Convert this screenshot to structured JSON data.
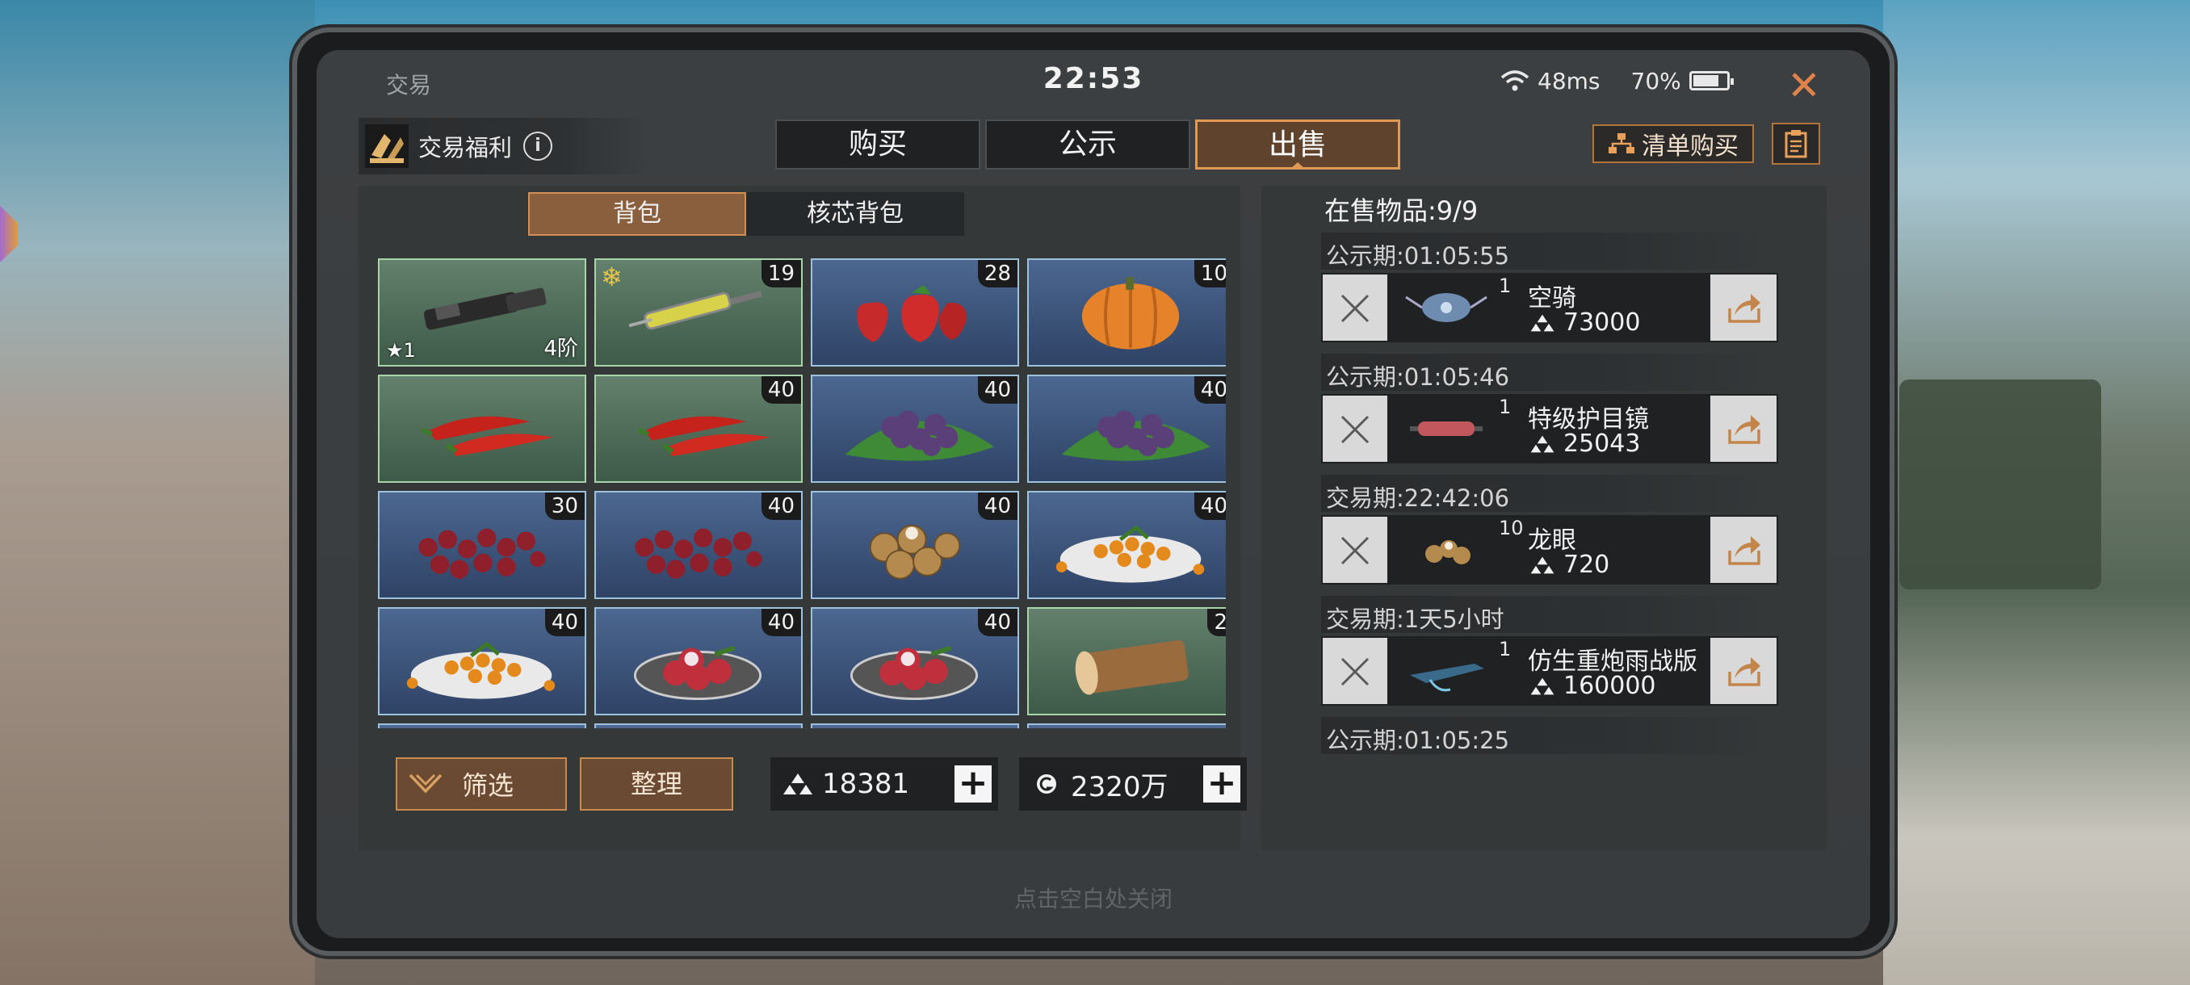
{
  "status": {
    "title": "交易",
    "time": "22:53",
    "latency": "48ms",
    "battery": "70%"
  },
  "header": {
    "welfare_label": "交易福利",
    "tabs": [
      {
        "label": "购买"
      },
      {
        "label": "公示"
      },
      {
        "label": "出售",
        "active": true
      }
    ],
    "list_buy_label": "清单购买"
  },
  "inventory": {
    "tabs": [
      {
        "label": "背包",
        "active": true
      },
      {
        "label": "核芯背包"
      }
    ],
    "items": [
      {
        "name": "muzzle",
        "style": "green",
        "tier": "4阶",
        "star": "★1"
      },
      {
        "name": "syringe",
        "style": "green",
        "count": "19",
        "frozen": true
      },
      {
        "name": "strawberry",
        "style": "blue",
        "count": "28"
      },
      {
        "name": "pumpkin",
        "style": "blue",
        "count": "10"
      },
      {
        "name": "chili",
        "style": "green"
      },
      {
        "name": "chili",
        "style": "green",
        "count": "40"
      },
      {
        "name": "blackberry",
        "style": "blue",
        "count": "40"
      },
      {
        "name": "blackberry",
        "style": "blue",
        "count": "40"
      },
      {
        "name": "cranberry",
        "style": "blue",
        "count": "30"
      },
      {
        "name": "cranberry",
        "style": "blue",
        "count": "40"
      },
      {
        "name": "longan",
        "style": "blue",
        "count": "40"
      },
      {
        "name": "goji-plate",
        "style": "blue",
        "count": "40"
      },
      {
        "name": "goji-plate",
        "style": "blue",
        "count": "40"
      },
      {
        "name": "lychee-plate",
        "style": "blue",
        "count": "40"
      },
      {
        "name": "lychee-plate",
        "style": "blue",
        "count": "40"
      },
      {
        "name": "log",
        "style": "green",
        "count": "2"
      }
    ],
    "filter_label": "筛选",
    "sort_label": "整理",
    "silver": "18381",
    "gold": "2320万"
  },
  "sale": {
    "title": "在售物品:9/9",
    "entries": [
      {
        "phase": "公示期:01:05:55",
        "qty": "1",
        "name": "空骑",
        "price": "73000",
        "thumb": "drone"
      },
      {
        "phase": "公示期:01:05:46",
        "qty": "1",
        "name": "特级护目镜",
        "price": "25043",
        "thumb": "goggles"
      },
      {
        "phase": "交易期:22:42:06",
        "qty": "10",
        "name": "龙眼",
        "price": "720",
        "thumb": "longan"
      },
      {
        "phase": "交易期:1天5小时",
        "qty": "1",
        "name": "仿生重炮雨战版",
        "price": "160000",
        "thumb": "gun"
      },
      {
        "phase": "公示期:01:05:25"
      }
    ]
  },
  "footer": {
    "hint": "点击空白处关闭"
  },
  "colors": {
    "accent": "#e09a55",
    "button_bg": "#6a4a32",
    "slot_blue": "#3b5579",
    "slot_green": "#4f6d58"
  }
}
